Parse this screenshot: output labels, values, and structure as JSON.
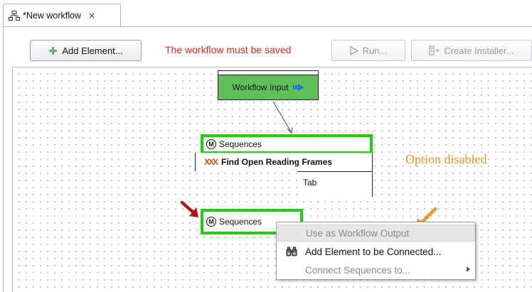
{
  "tab": {
    "title": "*New workflow",
    "close": "×",
    "icon": "workflow-icon"
  },
  "toolbar": {
    "add_element_label": "Add Element...",
    "warning_text": "The workflow must be saved",
    "run_label": "Run...",
    "create_installer_label": "Create Installer...",
    "colors": {
      "warning": "#e8241c"
    }
  },
  "workflow": {
    "input_node_label": "Workflow Input",
    "input_port_label": "Sequences",
    "process_label": "Find Open Reading Frames",
    "output_port_label": "Sequences",
    "output_port_partial": "Tab",
    "port_marker": "M",
    "colors": {
      "input_node": "#5fbf58",
      "port_border": "#20d010"
    }
  },
  "annotation": {
    "text": "Option disabled",
    "color": "#f0932b"
  },
  "context_menu": {
    "items": [
      {
        "label": "Use as Workflow Output",
        "enabled": false
      },
      {
        "label": "Add Element to be Connected...",
        "enabled": true,
        "icon": "binoculars-icon"
      },
      {
        "label": "Connect Sequences to...",
        "enabled": false,
        "has_submenu": true
      }
    ]
  }
}
